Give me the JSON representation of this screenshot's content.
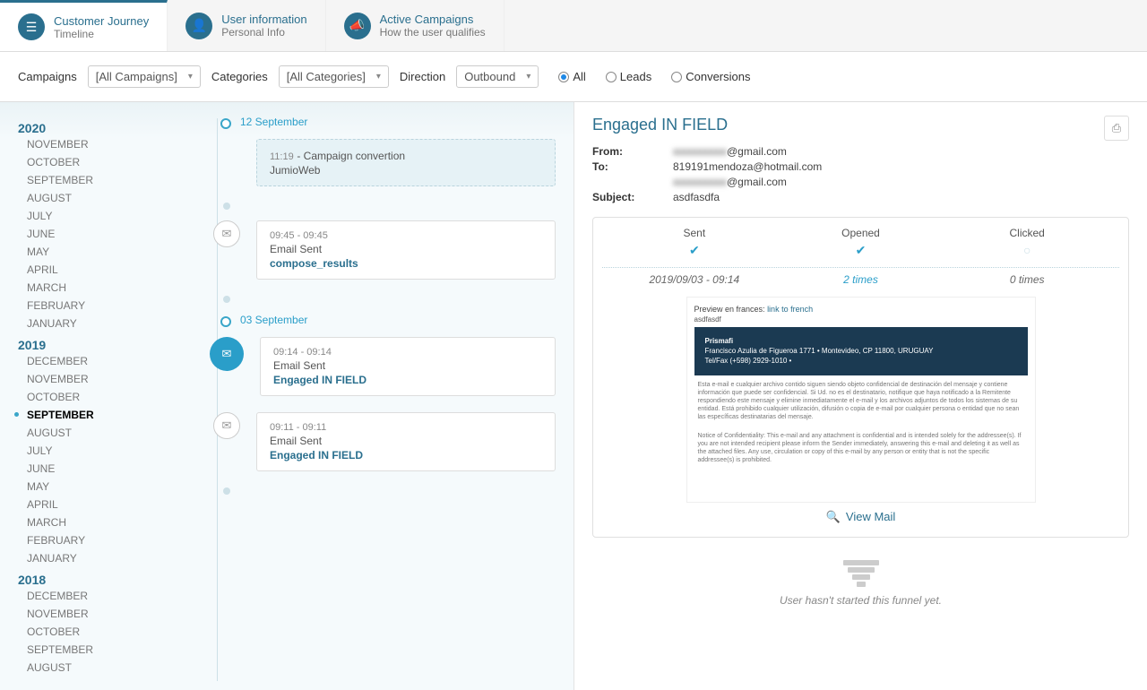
{
  "tabs": [
    {
      "title": "Customer Journey",
      "sub": "Timeline",
      "icon": "☰"
    },
    {
      "title": "User information",
      "sub": "Personal Info",
      "icon": "👤"
    },
    {
      "title": "Active Campaigns",
      "sub": "How the user qualifies",
      "icon": "📣"
    }
  ],
  "filters": {
    "campaigns_label": "Campaigns",
    "campaigns_value": "[All Campaigns]",
    "categories_label": "Categories",
    "categories_value": "[All Categories]",
    "direction_label": "Direction",
    "direction_value": "Outbound",
    "radios": {
      "all": "All",
      "leads": "Leads",
      "conversions": "Conversions"
    }
  },
  "years": [
    {
      "year": "2020",
      "months": [
        "NOVEMBER",
        "OCTOBER",
        "SEPTEMBER",
        "AUGUST",
        "JULY",
        "JUNE",
        "MAY",
        "APRIL",
        "MARCH",
        "FEBRUARY",
        "JANUARY"
      ]
    },
    {
      "year": "2019",
      "months": [
        "DECEMBER",
        "NOVEMBER",
        "OCTOBER",
        "SEPTEMBER",
        "AUGUST",
        "JULY",
        "JUNE",
        "MAY",
        "APRIL",
        "MARCH",
        "FEBRUARY",
        "JANUARY"
      ]
    },
    {
      "year": "2018",
      "months": [
        "DECEMBER",
        "NOVEMBER",
        "OCTOBER",
        "SEPTEMBER",
        "AUGUST"
      ]
    }
  ],
  "active_month": "SEPTEMBER",
  "active_year": "2019",
  "timeline": {
    "groups": [
      {
        "date": "12 September",
        "items": [
          {
            "style": "dashed",
            "time": "11:19",
            "line1": "- Campaign convertion",
            "line2": "JumioWeb"
          },
          {
            "icon": "mail",
            "time": "09:45 - 09:45",
            "line1": "Email Sent",
            "line2": "compose_results"
          }
        ]
      },
      {
        "date": "03 September",
        "items": [
          {
            "icon": "mail-big",
            "time": "09:14 - 09:14",
            "line1": "Email Sent",
            "line2": "Engaged IN FIELD"
          },
          {
            "icon": "mail",
            "time": "09:11 - 09:11",
            "line1": "Email Sent",
            "line2": "Engaged IN FIELD"
          }
        ]
      }
    ]
  },
  "detail": {
    "title": "Engaged IN FIELD",
    "from_label": "From:",
    "from_value_blur": "xxxxxxxxxx",
    "from_value_suffix": "@gmail.com",
    "to_label": "To:",
    "to_value": "819191mendoza@hotmail.com",
    "cc_blur": "xxxxxxxxxx",
    "cc_suffix": "@gmail.com",
    "subject_label": "Subject:",
    "subject_value": "asdfasdfa",
    "track": {
      "sent": {
        "label": "Sent",
        "value": "2019/09/03 - 09:14"
      },
      "opened": {
        "label": "Opened",
        "value": "2 times"
      },
      "clicked": {
        "label": "Clicked",
        "value": "0 times"
      }
    },
    "preview": {
      "lang_prefix": "Preview en frances:",
      "lang_link": "link to french",
      "company": "Prismafi",
      "addr": "Francisco Azulia de Figueroa 1771 • Montevideo, CP 11800, URUGUAY",
      "tel": "Tel/Fax (+598) 2929-1010 •"
    },
    "view_mail": "View Mail",
    "funnel_msg": "User hasn't started this funnel yet."
  }
}
